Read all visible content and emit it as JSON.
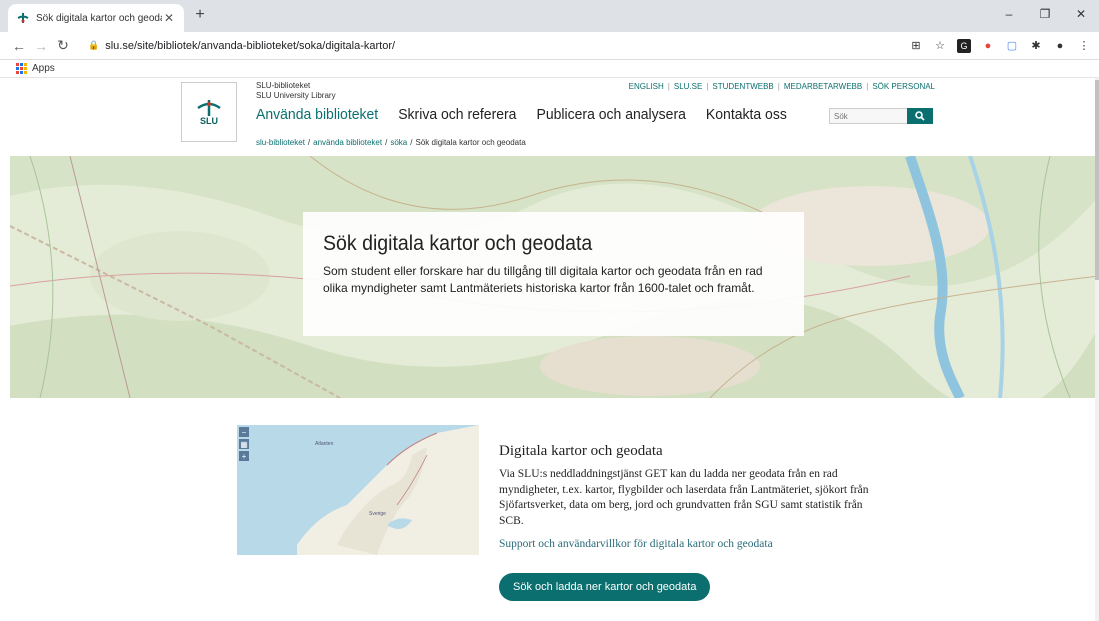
{
  "browser": {
    "tab_title": "Sök digitala kartor och geodata |",
    "url": "slu.se/site/bibliotek/anvanda-biblioteket/soka/digitala-kartor/",
    "bookmarks_apps": "Apps",
    "minimize": "–",
    "maximize": "❐",
    "close": "✕"
  },
  "header": {
    "org_line1": "SLU-biblioteket",
    "org_line2": "SLU University Library",
    "logo_text": "SLU",
    "top_links": [
      "ENGLISH",
      "SLU.SE",
      "STUDENTWEBB",
      "MEDARBETARWEBB",
      "SÖK PERSONAL"
    ],
    "nav": [
      "Använda biblioteket",
      "Skriva och referera",
      "Publicera och analysera",
      "Kontakta oss"
    ],
    "search_placeholder": "Sök",
    "breadcrumb": [
      "slu-biblioteket",
      "använda biblioteket",
      "söka",
      "Sök digitala kartor och geodata"
    ]
  },
  "hero": {
    "title": "Sök digitala kartor och geodata",
    "text": "Som student eller forskare har du tillgång till digitala kartor och geodata från en rad olika myndigheter samt Lantmäteriets historiska kartor från 1600-talet och framåt."
  },
  "feature": {
    "heading": "Digitala kartor och geodata",
    "body": "Via SLU:s neddladdningstjänst GET kan du ladda ner geodata från en rad myndigheter, t.ex. kartor, flygbilder och laserdata från Lantmäteriet, sjökort från Sjöfartsverket, data om berg, jord och grundvatten från SGU samt statistik från SCB.",
    "link": "Support och användarvillkor för digitala kartor och geodata",
    "button": "Sök och ladda ner kartor och geodata",
    "map_labels": [
      "Atlanten",
      "Sverige"
    ]
  },
  "colors": {
    "accent": "#0b6f6f",
    "link": "#2a6b7a"
  }
}
